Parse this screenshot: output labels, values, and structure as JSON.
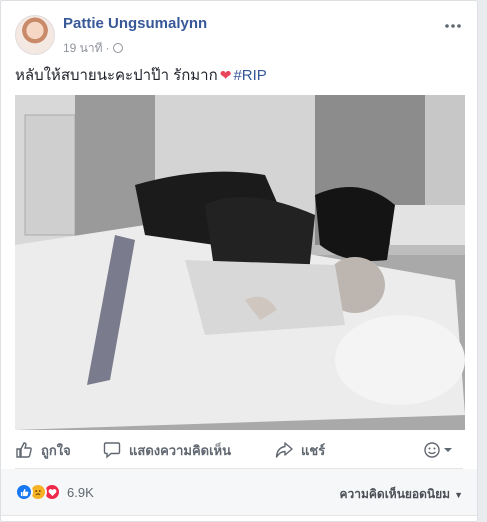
{
  "post": {
    "author": "Pattie Ungsumalynn",
    "timestamp": "19 นาที",
    "privacy_icon": "globe-icon",
    "caption_text": "หลับให้สบายนะคะปาป๊า รักมาก",
    "caption_emoji": "❤",
    "hashtag": "#RIP"
  },
  "actions": {
    "like": "ถูกใจ",
    "comment": "แสดงความคิดเห็น",
    "share": "แชร์"
  },
  "reactions": {
    "types": [
      "like",
      "sad",
      "love"
    ],
    "count": "6.9K",
    "sort_label": "ความคิดเห็นยอดนิยม"
  },
  "colors": {
    "link": "#385898",
    "heart": "#e9445a",
    "like": "#1877f2",
    "sad": "#f7b125",
    "love": "#f0284a"
  }
}
